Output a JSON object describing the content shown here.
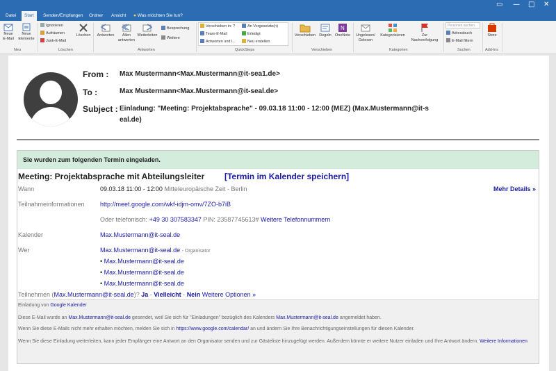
{
  "titlebar": {
    "minimize": "▭",
    "restore": "—",
    "maximize": "□",
    "close": "✕"
  },
  "tabs": [
    "Datei",
    "Start",
    "Senden/Empfangen",
    "Ordner",
    "Ansicht"
  ],
  "tell_me": "Was möchten Sie tun?",
  "ribbon": {
    "neu": {
      "new_email": "Neue E-Mail",
      "new_items": "Neue Elemente",
      "group": "Neu"
    },
    "loeschen": {
      "ignore": "Ignorieren",
      "cleanup": "Aufräumen",
      "junk": "Junk-E-Mail",
      "delete": "Löschen",
      "group": "Löschen"
    },
    "antworten": {
      "reply": "Antworten",
      "reply_all": "Allen antworten",
      "forward": "Weiterleiten",
      "meeting": "Besprechung",
      "more": "Weitere",
      "group": "Antworten"
    },
    "quicksteps": {
      "move_to": "Verschieben in: ?",
      "team_email": "Team-E-Mail",
      "reply_delete": "Antworten und l...",
      "to_manager": "An Vorgesetzte(n)",
      "done": "Erledigt",
      "create_new": "Neu erstellen",
      "group": "QuickSteps"
    },
    "verschieben": {
      "move": "Verschieben",
      "rules": "Regeln",
      "onenote": "OneNote",
      "group": "Verschieben"
    },
    "kategorien": {
      "unread": "Ungelesen/ Gelesen",
      "categorize": "Kategorisieren",
      "followup": "Zur Nachverfolgung",
      "group": "Kategorien"
    },
    "suchen": {
      "search_people": "Personen suchen",
      "address_book": "Adressbuch",
      "filter_email": "E-Mail filtern",
      "group": "Suchen"
    },
    "addins": {
      "store": "Store",
      "group": "Add-Ins"
    }
  },
  "email": {
    "from_label": "From :",
    "from_value": "Max Mustermann<Max.Mustermann@it-sea1.de>",
    "to_label": "To :",
    "to_value": "Max Mustermann<Max.Mustermann@it-seal.de>",
    "subject_label": "Subject :",
    "subject_line1": "Einladung: \"Meeting: Projektabsprache\" - 09.03.18 11:00 - 12:00 (MEZ) (Max.Mustermann@it-s",
    "subject_line2": "eal.de)"
  },
  "invite": {
    "banner": "Sie wurden zum folgenden Termin eingeladen.",
    "title": "Meeting: Projektabsprache mit Abteilungsleiter",
    "save_calendar": "[Termin im Kalender speichern]",
    "wann_label": "Wann",
    "wann_value": "09.03.18 11:00 - 12:00",
    "wann_tz": "Mitteleuropäische Zeit - Berlin",
    "more_details": "Mehr Details »",
    "teilnahme_label": "Teilnahmeinformationen",
    "teilnahme_link": "http://meet.google.com/wkf-idjm-omv/7ZO-b7iB",
    "phone_prefix": "Oder telefonisch:",
    "phone_number": "+49 30 307583347",
    "pin": "PIN: 23587745613#",
    "more_phones": "Weitere Telefonnummern",
    "kalender_label": "Kalender",
    "kalender_value": "Max.Mustermann@it-seal.de",
    "wer_label": "Wer",
    "organizer": "Max.Mustermann@it-seal.de",
    "organizer_role": "- Organisator",
    "guests": [
      "Max.Mustermann@it-seal.de",
      "Max.Mustermann@it-seal.de",
      "Max.Mustermann@it-seal.de"
    ],
    "bullet": "•",
    "rsvp_prefix": "Teilnehmen (",
    "rsvp_email": "Max.Mustermann@it-seal.de",
    "rsvp_suffix": ")?",
    "yes": "Ja",
    "dash": "-",
    "maybe": "Vielleicht",
    "no": "Nein",
    "more_options": "Weitere Optionen »"
  },
  "footer": {
    "invite_from": "Einladung von",
    "google_calendar": "Google Kalender",
    "l2a": "Diese E-Mail wurde an",
    "l2b": "Max.Mustermann@it-seal.de",
    "l2c": "gesendet, weil Sie sich für \"Einladungen\" bezüglich des Kalenders",
    "l2d": "Max.Mustermann@it-seal.de",
    "l2e": "angemeldet haben.",
    "l3a": "Wenn Sie diese E-Mails nicht mehr erhalten möchten, melden Sie sich in",
    "l3b": "https://www.google.com/calendar/",
    "l3c": "an und ändern Sie Ihre Benachrichtigungseinstellungen für diesen Kalender.",
    "l4a": "Wenn Sie diese Einladung weiterleiten, kann jeder Empfänger eine Antwort an den Organisator senden und zur Gästeliste hinzugefügt werden. Außerdem könnte er weitere Nutzer einladen und Ihre Antwort ändern.",
    "l4b": "Weitere Informationen"
  }
}
